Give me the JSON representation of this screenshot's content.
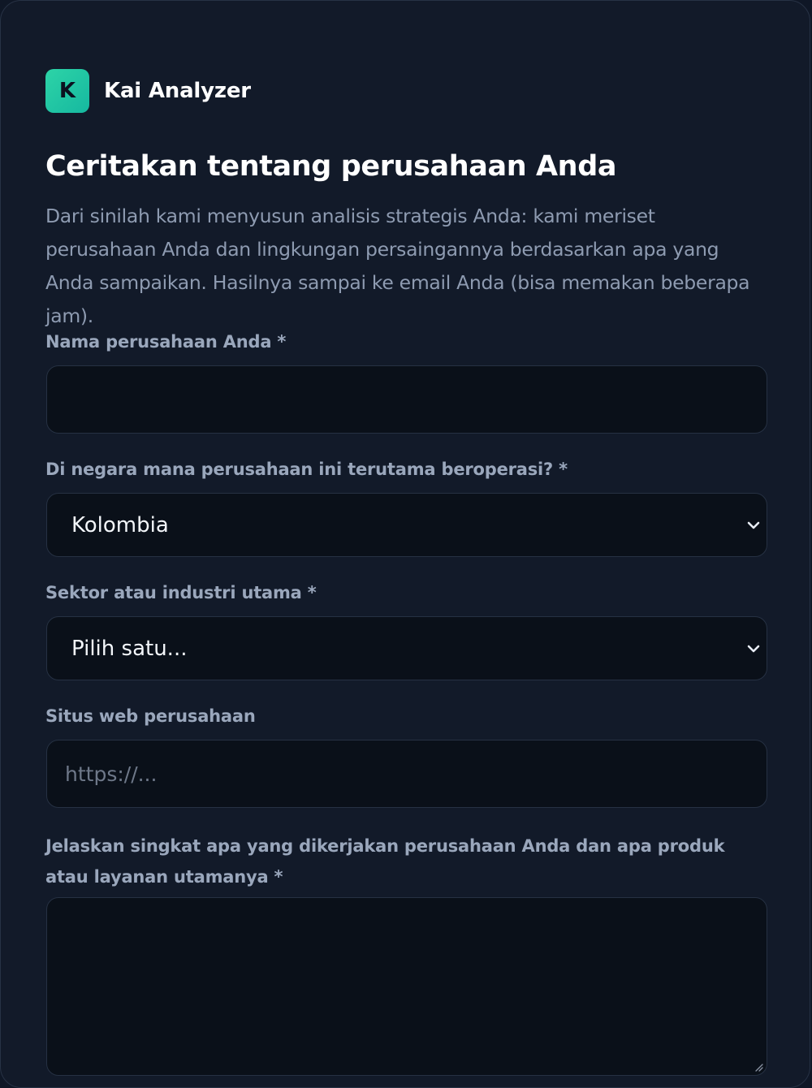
{
  "brand": {
    "logo_letter": "K",
    "name": "Kai Analyzer",
    "logo_color": "#1fc9a3"
  },
  "page": {
    "title": "Ceritakan tentang perusahaan Anda",
    "intro": "Dari sinilah kami menyusun analisis strategis Anda: kami meriset perusahaan Anda dan lingkungan persaingannya berdasarkan apa yang Anda sampaikan. Hasilnya sampai ke email Anda (bisa memakan beberapa jam)."
  },
  "form": {
    "company_name": {
      "label": "Nama perusahaan Anda *",
      "value": "",
      "placeholder": ""
    },
    "country": {
      "label": "Di negara mana perusahaan ini terutama beroperasi? *",
      "selected": "Kolombia",
      "icon": "chevron-down-icon"
    },
    "sector": {
      "label": "Sektor atau industri utama *",
      "selected": "Pilih satu...",
      "icon": "chevron-down-icon"
    },
    "website": {
      "label": "Situs web perusahaan",
      "value": "",
      "placeholder": "https://..."
    },
    "description": {
      "label": "Jelaskan singkat apa yang dikerjakan perusahaan Anda dan apa produk atau layanan utamanya *",
      "value": ""
    }
  },
  "colors": {
    "background": "#121a29",
    "field_background": "#0a1019",
    "label": "#9aa7bc",
    "intro": "#8e9bb1"
  }
}
